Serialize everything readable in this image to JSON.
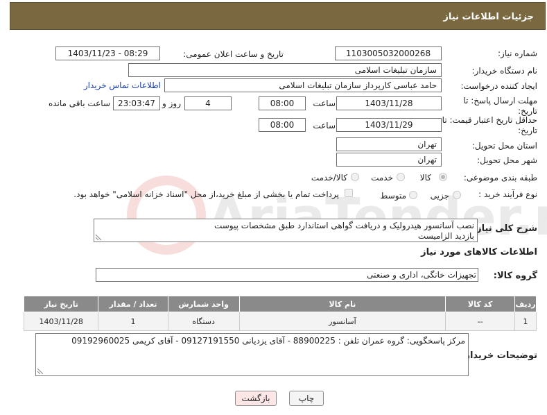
{
  "header": {
    "title": "جزئیات اطلاعات نیاز"
  },
  "fields": {
    "need_number_label": "شماره نیاز:",
    "need_number": "1103005032000268",
    "announce_label": "تاریخ و ساعت اعلان عمومی:",
    "announce_value": "1403/11/23 - 08:29",
    "buyer_org_label": "نام دستگاه خریدار:",
    "buyer_org": "سازمان تبلیغات اسلامی",
    "creator_label": "ایجاد کننده درخواست:",
    "creator": "حامد عباسی کارپرداز سازمان تبلیغات اسلامی",
    "contact_link": "اطلاعات تماس خریدار",
    "deadline_label_1": "مهلت ارسال پاسخ: تا",
    "deadline_label_2": "تاریخ:",
    "deadline_date": "1403/11/28",
    "time_label": "ساعت",
    "deadline_time": "08:00",
    "days_value": "4",
    "days_label": "روز و",
    "remaining_time": "23:03:47",
    "remaining_label": "ساعت باقی مانده",
    "validity_label_1": "حداقل تاریخ اعتبار قیمت: تا",
    "validity_label_2": "تاریخ:",
    "validity_date": "1403/11/29",
    "validity_time": "08:00",
    "province_label": "استان محل تحویل:",
    "province": "تهران",
    "city_label": "شهر محل تحویل:",
    "city": "تهران",
    "category_label": "طبقه بندی موضوعی:",
    "category_options": [
      "کالا",
      "خدمت",
      "کالا/خدمت"
    ],
    "process_label": "نوع فرآیند خرید :",
    "process_options": [
      "جزیی",
      "متوسط"
    ],
    "payment_note": "پرداخت تمام یا بخشی از مبلغ خرید،از محل \"اسناد خزانه اسلامی\" خواهد بود.",
    "description_label": "شرح کلی نیاز:",
    "description_line1": "نصب آسانسور هیدرولیک و دریافت گواهی استاندارد طبق مشخصات پیوست",
    "description_line2": "بازدید الزامیست",
    "goods_info_title": "اطلاعات کالاهای مورد نیاز",
    "goods_group_label": "گروه کالا:",
    "goods_group": "تجهیزات خانگی، اداری و صنعتی"
  },
  "table": {
    "headers": [
      "ردیف",
      "کد کالا",
      "نام کالا",
      "واحد شمارش",
      "تعداد / مقدار",
      "تاریخ نیاز"
    ],
    "rows": [
      [
        "1",
        "--",
        "آسانسور",
        "دستگاه",
        "1",
        "1403/11/28"
      ]
    ]
  },
  "buyer_notes": {
    "label": "توضیحات خریدار:",
    "text": "مرکز پاسخگویی: گروه عمران تلفن : 88900225 - آقای یزدیانی 09127191550 - آقای کریمی 09192960025"
  },
  "buttons": {
    "print": "چاپ",
    "back": "بازگشت"
  },
  "watermark": {
    "text": "AriaTender.net"
  },
  "colors": {
    "header_bg": "#7a6840",
    "table_header_bg": "#8a8a8a",
    "link": "#1a3fae",
    "back_button_bg": "#fde6e6"
  }
}
